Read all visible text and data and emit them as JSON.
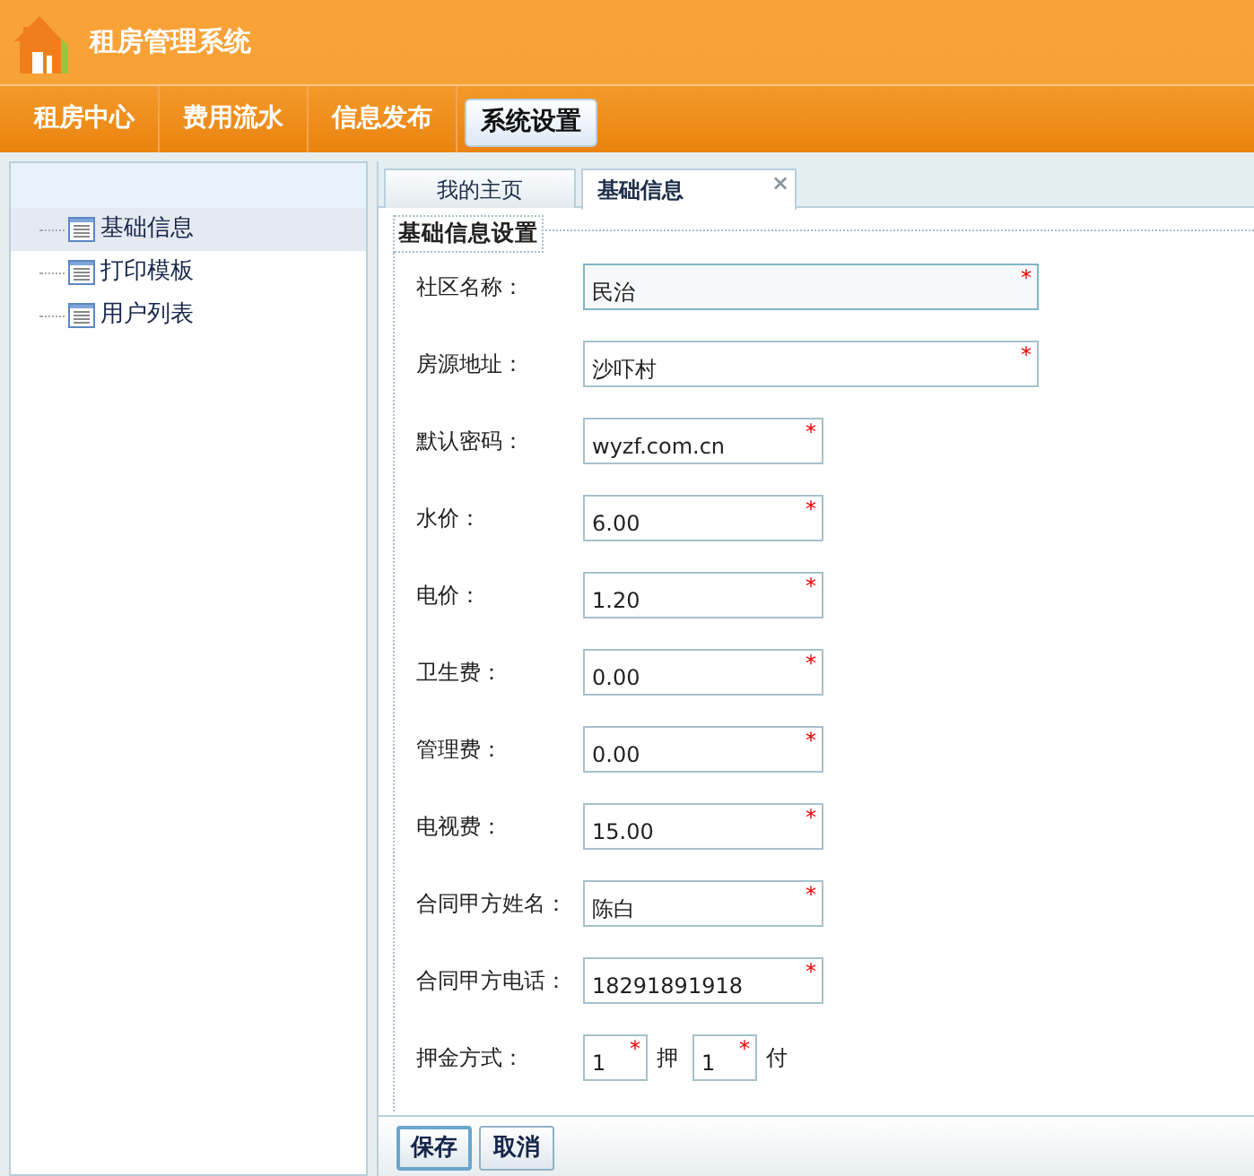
{
  "app": {
    "title": "租房管理系统"
  },
  "nav": [
    {
      "label": "租房中心",
      "selected": false
    },
    {
      "label": "费用流水",
      "selected": false
    },
    {
      "label": "信息发布",
      "selected": false
    },
    {
      "label": "系统设置",
      "selected": true
    }
  ],
  "sidebar": {
    "items": [
      {
        "label": "基础信息",
        "selected": true
      },
      {
        "label": "打印模板",
        "selected": false
      },
      {
        "label": "用户列表",
        "selected": false
      }
    ]
  },
  "tabs": [
    {
      "label": "我的主页",
      "selected": false
    },
    {
      "label": "基础信息",
      "selected": true,
      "close": "×"
    }
  ],
  "form": {
    "legend": "基础信息设置",
    "fields": [
      {
        "label": "社区名称：",
        "value": "民治",
        "mark": "*",
        "kind": "wide",
        "focused": true
      },
      {
        "label": "房源地址：",
        "value": "沙吓村",
        "mark": "*",
        "kind": "wide",
        "focused": false
      },
      {
        "label": "默认密码：",
        "value": "wyzf.com.cn",
        "mark": "*",
        "kind": "narrow",
        "focused": false
      },
      {
        "label": "水价：",
        "value": "6.00",
        "mark": "*",
        "kind": "narrow",
        "focused": false
      },
      {
        "label": "电价：",
        "value": "1.20",
        "mark": "*",
        "kind": "narrow",
        "focused": false
      },
      {
        "label": "卫生费：",
        "value": "0.00",
        "mark": "*",
        "kind": "narrow",
        "focused": false
      },
      {
        "label": "管理费：",
        "value": "0.00",
        "mark": "*",
        "kind": "narrow",
        "focused": false
      },
      {
        "label": "电视费：",
        "value": "15.00",
        "mark": "*",
        "kind": "narrow",
        "focused": false
      },
      {
        "label": "合同甲方姓名：",
        "value": "陈白",
        "mark": "*",
        "kind": "narrow",
        "focused": false
      },
      {
        "label": "合同甲方电话：",
        "value": "18291891918",
        "mark": "*",
        "kind": "narrow",
        "focused": false
      }
    ],
    "deposit": {
      "label": "押金方式：",
      "parts": [
        {
          "kind": "input",
          "value": "1",
          "mark": "*"
        },
        {
          "kind": "text",
          "text": "押"
        },
        {
          "kind": "input",
          "value": "1",
          "mark": "*"
        },
        {
          "kind": "text",
          "text": "付"
        }
      ]
    }
  },
  "buttons": [
    {
      "label": "保存",
      "focused": true
    },
    {
      "label": "取消",
      "focused": false
    }
  ]
}
